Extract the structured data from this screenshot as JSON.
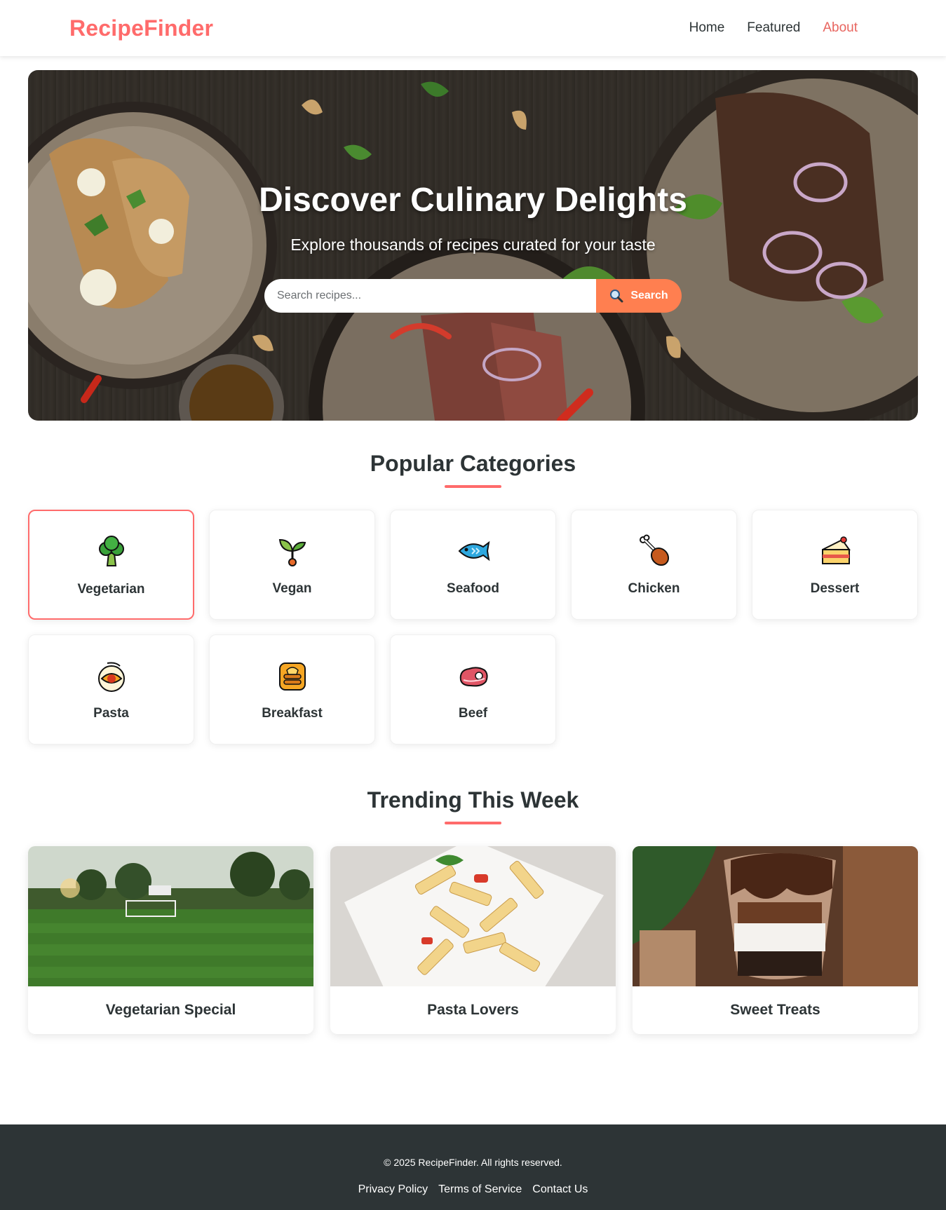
{
  "header": {
    "logo": "RecipeFinder",
    "nav": [
      {
        "label": "Home"
      },
      {
        "label": "Featured"
      },
      {
        "label": "About"
      }
    ],
    "active_nav": "About"
  },
  "hero": {
    "title": "Discover Culinary Delights",
    "subtitle": "Explore thousands of recipes curated for your taste",
    "search": {
      "placeholder": "Search recipes...",
      "value": "",
      "button_label": "Search",
      "button_icon": "magnifier-icon"
    }
  },
  "categories": {
    "title": "Popular Categories",
    "selected": "Vegetarian",
    "items": [
      {
        "label": "Vegetarian",
        "icon": "broccoli-icon"
      },
      {
        "label": "Vegan",
        "icon": "seedling-icon"
      },
      {
        "label": "Seafood",
        "icon": "fish-icon"
      },
      {
        "label": "Chicken",
        "icon": "drumstick-icon"
      },
      {
        "label": "Dessert",
        "icon": "cake-icon"
      },
      {
        "label": "Pasta",
        "icon": "pasta-bowl-icon"
      },
      {
        "label": "Breakfast",
        "icon": "pancakes-icon"
      },
      {
        "label": "Beef",
        "icon": "steak-icon"
      }
    ]
  },
  "trending": {
    "title": "Trending This Week",
    "items": [
      {
        "label": "Vegetarian Special"
      },
      {
        "label": "Pasta Lovers"
      },
      {
        "label": "Sweet Treats"
      }
    ]
  },
  "footer": {
    "copyright": "© 2025 RecipeFinder. All rights reserved.",
    "links": [
      {
        "label": "Privacy Policy"
      },
      {
        "label": "Terms of Service"
      },
      {
        "label": "Contact Us"
      }
    ]
  },
  "colors": {
    "brand": "#ff6b6b",
    "search_button": "#ff7f50",
    "text": "#2d3436",
    "footer_bg": "#2d3436"
  }
}
